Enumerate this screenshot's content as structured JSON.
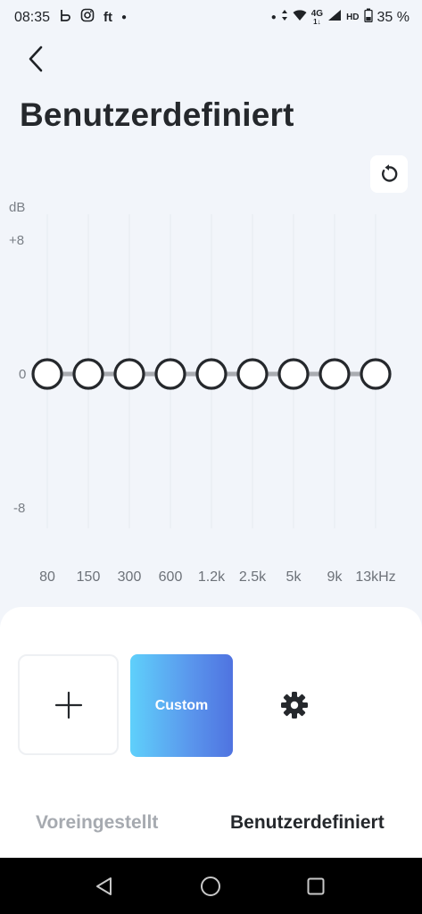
{
  "status_bar": {
    "time": "08:35",
    "app_icons": [
      "b-icon",
      "instagram-icon",
      "ft"
    ],
    "ft_label": "ft",
    "network": "4G",
    "network_sub": "1↓",
    "hd": "HD",
    "battery": "35 %"
  },
  "header": {
    "title": "Benutzerdefiniert"
  },
  "equalizer": {
    "db_unit": "dB",
    "db_max": "+8",
    "db_zero": "0",
    "db_min": "-8",
    "bands": [
      {
        "label": "80",
        "gain": 0
      },
      {
        "label": "150",
        "gain": 0
      },
      {
        "label": "300",
        "gain": 0
      },
      {
        "label": "600",
        "gain": 0
      },
      {
        "label": "1.2k",
        "gain": 0
      },
      {
        "label": "2.5k",
        "gain": 0
      },
      {
        "label": "5k",
        "gain": 0
      },
      {
        "label": "9k",
        "gain": 0
      },
      {
        "label": "13kHz",
        "gain": 0
      }
    ],
    "range": [
      -8,
      8
    ]
  },
  "presets": {
    "custom_label": "Custom"
  },
  "tabs": {
    "preset": "Voreingestellt",
    "custom": "Benutzerdefiniert",
    "active": "custom"
  },
  "colors": {
    "accent_start": "#5fd0fb",
    "accent_end": "#4f73e0",
    "background": "#f2f5fa"
  }
}
